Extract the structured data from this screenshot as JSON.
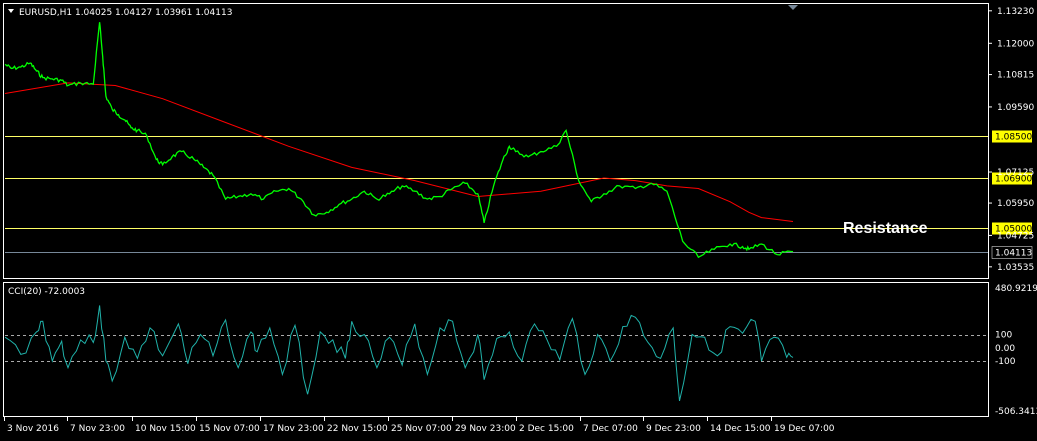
{
  "header": {
    "symbol_line": "EURUSD,H1  1.04025 1.04127 1.03961 1.04113",
    "indicator_line": "CCI(20) -72.0003"
  },
  "colors": {
    "background": "#000000",
    "price": "#00ff00",
    "ma": "#ff0000",
    "cci": "#20b2aa",
    "level_line": "#ffff66",
    "label_bg": "#ffff00",
    "axis": "#ffffff"
  },
  "chart_data": [
    {
      "type": "line",
      "title": "EURUSD,H1",
      "ohlc_last": {
        "open": 1.04025,
        "high": 1.04127,
        "low": 1.03961,
        "close": 1.04113
      },
      "x_ticks": [
        "3 Nov 2016",
        "7 Nov 23:00",
        "10 Nov 15:00",
        "15 Nov 07:00",
        "17 Nov 23:00",
        "22 Nov 15:00",
        "25 Nov 07:00",
        "29 Nov 23:00",
        "2 Dec 15:00",
        "7 Dec 07:00",
        "9 Dec 23:00",
        "14 Dec 15:00",
        "19 Dec 07:00"
      ],
      "y_ticks": [
        "1.13230",
        "1.12000",
        "1.10815",
        "1.09590",
        "1.07125",
        "1.05950",
        "1.04725",
        "1.03535"
      ],
      "ylim": [
        1.0315,
        1.1345
      ],
      "series": [
        {
          "role": "price",
          "x": [
            0,
            2,
            5,
            8,
            10,
            12,
            15,
            18,
            20,
            24,
            28,
            30,
            31,
            32,
            34,
            36,
            38,
            40,
            42,
            45,
            48,
            50,
            53,
            56,
            60,
            63,
            66,
            70,
            74,
            78,
            82,
            86,
            90,
            94,
            98,
            102,
            106,
            110,
            114,
            118,
            122,
            126,
            130,
            134,
            138,
            142,
            146,
            150,
            152,
            155,
            158,
            160,
            162,
            166,
            170,
            175,
            178,
            182,
            186,
            190,
            195,
            200,
            205,
            210,
            215,
            220,
            225,
            230,
            234,
            236,
            240,
            245,
            250
          ],
          "y": [
            1.112,
            1.1105,
            1.111,
            1.1125,
            1.1095,
            1.107,
            1.1065,
            1.106,
            1.104,
            1.105,
            1.1045,
            1.128,
            1.115,
            1.1,
            1.095,
            1.093,
            1.091,
            1.088,
            1.087,
            1.085,
            1.076,
            1.074,
            1.077,
            1.079,
            1.076,
            1.073,
            1.07,
            1.061,
            1.062,
            1.063,
            1.061,
            1.064,
            1.065,
            1.061,
            1.055,
            1.056,
            1.059,
            1.061,
            1.064,
            1.061,
            1.063,
            1.066,
            1.064,
            1.061,
            1.062,
            1.065,
            1.067,
            1.063,
            1.052,
            1.066,
            1.076,
            1.081,
            1.079,
            1.077,
            1.079,
            1.081,
            1.087,
            1.068,
            1.06,
            1.063,
            1.066,
            1.065,
            1.067,
            1.064,
            1.045,
            1.039,
            1.042,
            1.044,
            1.043,
            1.042,
            1.044,
            1.04,
            1.0411
          ]
        },
        {
          "role": "moving average",
          "x": [
            0,
            20,
            35,
            50,
            70,
            90,
            110,
            130,
            150,
            170,
            180,
            190,
            200,
            210,
            220,
            230,
            236,
            240,
            250
          ],
          "y": [
            1.101,
            1.105,
            1.104,
            1.099,
            1.09,
            1.081,
            1.073,
            1.068,
            1.062,
            1.064,
            1.0665,
            1.069,
            1.068,
            1.066,
            1.065,
            1.06,
            1.056,
            1.054,
            1.0525
          ]
        }
      ],
      "levels": [
        {
          "value": 1.085,
          "label": "1.08500"
        },
        {
          "value": 1.069,
          "label": "1.06900"
        },
        {
          "value": 1.05,
          "label": "1.05000"
        }
      ],
      "current_price": {
        "value": 1.04113,
        "label": "1.04113"
      },
      "annotations": [
        "Resistance"
      ]
    },
    {
      "type": "line",
      "title": "CCI(20) -72.0003",
      "y_ticks": [
        "480.9219",
        "100",
        "0.00",
        "-100",
        "-506.3413"
      ],
      "ylim": [
        -506.3413,
        480.9219
      ],
      "levels": [
        100,
        -100
      ],
      "series": [
        {
          "role": "oscillator",
          "x": [
            0,
            5,
            10,
            12,
            15,
            18,
            20,
            24,
            28,
            30,
            32,
            34,
            38,
            42,
            46,
            50,
            55,
            58,
            62,
            66,
            70,
            74,
            78,
            80,
            84,
            88,
            92,
            96,
            100,
            104,
            108,
            110,
            114,
            118,
            122,
            126,
            130,
            134,
            138,
            142,
            146,
            150,
            152,
            156,
            160,
            164,
            168,
            172,
            176,
            180,
            184,
            188,
            192,
            196,
            200,
            204,
            208,
            212,
            214,
            218,
            222,
            226,
            230,
            234,
            238,
            240,
            244,
            248,
            250
          ],
          "y": [
            80,
            -50,
            120,
            200,
            -100,
            50,
            -150,
            60,
            40,
            320,
            -100,
            -250,
            80,
            -80,
            150,
            -60,
            180,
            -120,
            100,
            -60,
            210,
            -150,
            120,
            -30,
            150,
            -200,
            170,
            -350,
            120,
            60,
            -80,
            200,
            100,
            -150,
            80,
            -130,
            180,
            -200,
            150,
            200,
            -150,
            100,
            -240,
            70,
            120,
            -100,
            180,
            60,
            -90,
            220,
            -200,
            100,
            -100,
            160,
            230,
            40,
            -80,
            150,
            -400,
            100,
            80,
            -60,
            160,
            110,
            200,
            -100,
            80,
            -72,
            -72
          ]
        }
      ]
    }
  ]
}
